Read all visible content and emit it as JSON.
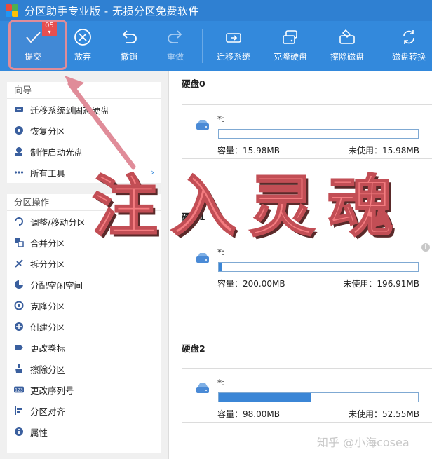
{
  "window": {
    "title": "分区助手专业版 - 无损分区免费软件"
  },
  "toolbar": {
    "commit": {
      "label": "提交",
      "badge": "05",
      "icon": "check-icon"
    },
    "discard": {
      "label": "放弃",
      "icon": "cancel-circle-icon"
    },
    "undo": {
      "label": "撤销",
      "icon": "undo-icon"
    },
    "redo": {
      "label": "重做",
      "icon": "redo-icon"
    },
    "migrate": {
      "label": "迁移系统",
      "icon": "migrate-os-icon"
    },
    "clone_disk": {
      "label": "克隆硬盘",
      "icon": "clone-disk-icon"
    },
    "wipe_disk": {
      "label": "擦除磁盘",
      "icon": "wipe-disk-icon"
    },
    "convert_disk": {
      "label": "磁盘转换",
      "icon": "convert-disk-icon"
    }
  },
  "sidebar": {
    "wizard": {
      "title": "向导",
      "items": [
        {
          "label": "迁移系统到固态硬盘",
          "icon": "migrate-icon"
        },
        {
          "label": "恢复分区",
          "icon": "recover-icon"
        },
        {
          "label": "制作启动光盘",
          "icon": "boot-media-icon"
        },
        {
          "label": "所有工具",
          "icon": "more-icon"
        }
      ]
    },
    "partition_ops": {
      "title": "分区操作",
      "items": [
        {
          "label": "调整/移动分区",
          "icon": "resize-icon"
        },
        {
          "label": "合并分区",
          "icon": "merge-icon"
        },
        {
          "label": "拆分分区",
          "icon": "split-icon"
        },
        {
          "label": "分配空闲空间",
          "icon": "allocate-icon"
        },
        {
          "label": "克隆分区",
          "icon": "clone-partition-icon"
        },
        {
          "label": "创建分区",
          "icon": "create-partition-icon"
        },
        {
          "label": "更改卷标",
          "icon": "label-icon"
        },
        {
          "label": "擦除分区",
          "icon": "wipe-partition-icon"
        },
        {
          "label": "更改序列号",
          "icon": "serial-icon"
        },
        {
          "label": "分区对齐",
          "icon": "align-icon"
        },
        {
          "label": "属性",
          "icon": "info-icon"
        }
      ]
    }
  },
  "disks": [
    {
      "title": "硬盘0",
      "volume": "*:",
      "capacity": "容量：15.98MB",
      "unused": "未使用：15.98MB",
      "used_fraction": 0.0
    },
    {
      "title": "硬盘1",
      "volume": "*:",
      "capacity": "容量：200.00MB",
      "unused": "未使用：196.91MB",
      "used_fraction": 0.015
    },
    {
      "title": "硬盘2",
      "volume": "*:",
      "capacity": "容量：98.00MB",
      "unused": "未使用：52.55MB",
      "used_fraction": 0.46
    }
  ],
  "overlay": {
    "text": "注入灵魂"
  },
  "watermark": {
    "text": "知乎 @小海cosea"
  },
  "colors": {
    "titlebar": "#2f80d2",
    "toolbar": "#3389dc",
    "annotation": "#e08c99",
    "bar_fill": "#3b86d6",
    "overlay": "#f47c80"
  }
}
